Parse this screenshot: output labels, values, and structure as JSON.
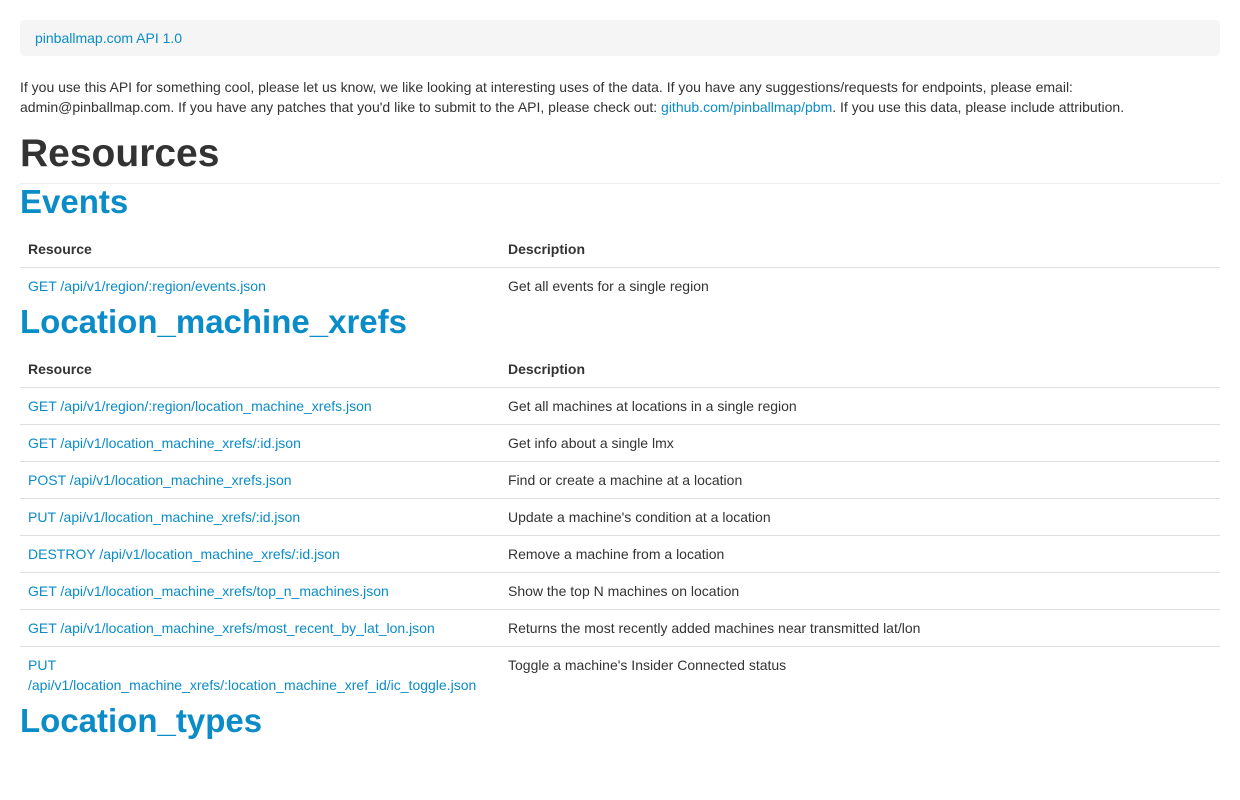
{
  "breadcrumb": {
    "label": "pinballmap.com API 1.0"
  },
  "intro": {
    "text_before_link": "If you use this API for something cool, please let us know, we like looking at interesting uses of the data. If you have any suggestions/requests for endpoints, please email: admin@pinballmap.com. If you have any patches that you'd like to submit to the API, please check out: ",
    "link_text": "github.com/pinballmap/pbm",
    "text_after_link": ". If you use this data, please include attribution."
  },
  "page_title": "Resources",
  "sections": [
    {
      "title": "Events",
      "headers": {
        "resource": "Resource",
        "description": "Description"
      },
      "rows": [
        {
          "resource": "GET /api/v1/region/:region/events.json",
          "description": "Get all events for a single region"
        }
      ]
    },
    {
      "title": "Location_machine_xrefs",
      "headers": {
        "resource": "Resource",
        "description": "Description"
      },
      "rows": [
        {
          "resource": "GET /api/v1/region/:region/location_machine_xrefs.json",
          "description": "Get all machines at locations in a single region"
        },
        {
          "resource": "GET /api/v1/location_machine_xrefs/:id.json",
          "description": "Get info about a single lmx"
        },
        {
          "resource": "POST /api/v1/location_machine_xrefs.json",
          "description": "Find or create a machine at a location"
        },
        {
          "resource": "PUT /api/v1/location_machine_xrefs/:id.json",
          "description": "Update a machine's condition at a location"
        },
        {
          "resource": "DESTROY /api/v1/location_machine_xrefs/:id.json",
          "description": "Remove a machine from a location"
        },
        {
          "resource": "GET /api/v1/location_machine_xrefs/top_n_machines.json",
          "description": "Show the top N machines on location"
        },
        {
          "resource": "GET /api/v1/location_machine_xrefs/most_recent_by_lat_lon.json",
          "description": "Returns the most recently added machines near transmitted lat/lon"
        },
        {
          "resource": "PUT /api/v1/location_machine_xrefs/:location_machine_xref_id/ic_toggle.json",
          "description": "Toggle a machine's Insider Connected status"
        }
      ]
    },
    {
      "title": "Location_types"
    }
  ]
}
